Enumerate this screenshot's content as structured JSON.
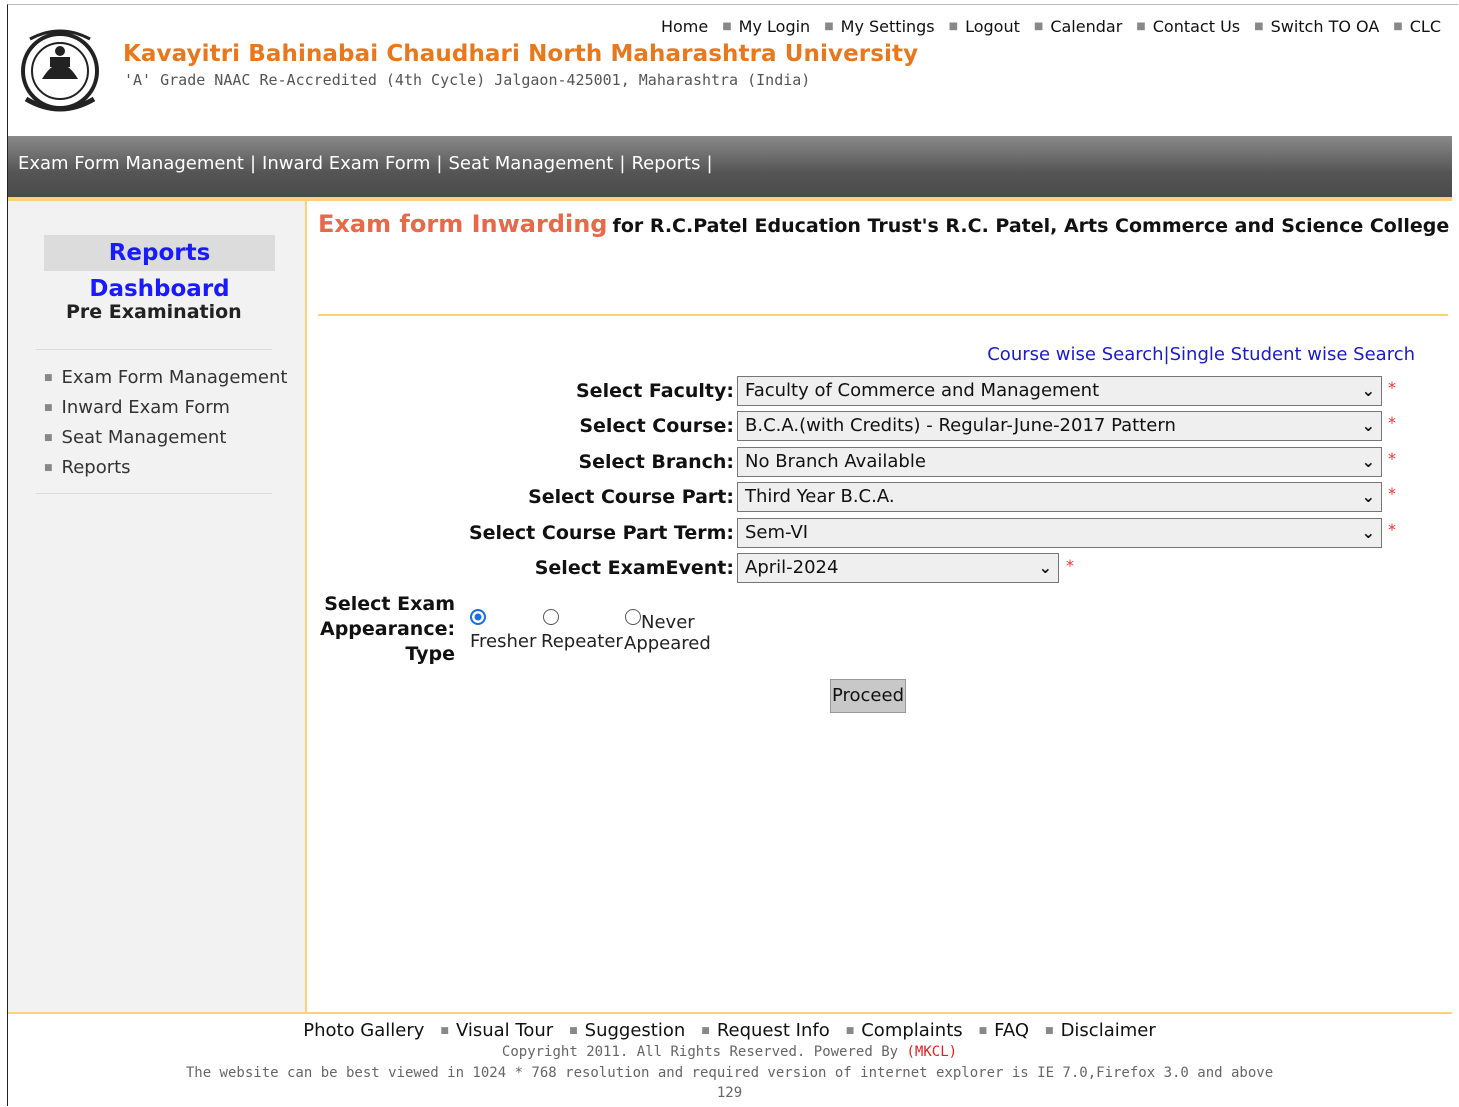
{
  "header": {
    "university_name": "Kavayitri Bahinabai Chaudhari North Maharashtra University",
    "subtitle": "'A' Grade NAAC Re-Accredited (4th Cycle) Jalgaon-425001, Maharashtra (India)",
    "top_links": [
      "Home",
      "My Login",
      "My Settings",
      "Logout",
      "Calendar",
      "Contact Us",
      "Switch TO OA",
      "CLC"
    ]
  },
  "navbar": {
    "items": [
      "Exam Form Management",
      "Inward Exam Form",
      "Seat Management",
      "Reports"
    ]
  },
  "sidebar": {
    "title": "Reports Dashboard",
    "section": "Pre Examination",
    "items": [
      "Exam Form Management",
      "Inward Exam Form",
      "Seat Management",
      "Reports"
    ]
  },
  "main": {
    "title": "Exam form Inwarding",
    "title_suffix": "for R.C.Patel Education Trust's R.C. Patel, Arts Commerce and Science College",
    "search_links": [
      "Course wise Search",
      "Single Student wise Search"
    ],
    "search_sep": "|",
    "fields": {
      "faculty": {
        "label": "Select Faculty",
        "value": "Faculty of Commerce and Management"
      },
      "course": {
        "label": "Select Course",
        "value": "B.C.A.(with Credits) - Regular-June-2017 Pattern"
      },
      "branch": {
        "label": "Select Branch",
        "value": "No Branch Available"
      },
      "course_part": {
        "label": "Select Course Part",
        "value": "Third Year B.C.A."
      },
      "course_part_term": {
        "label": "Select Course Part Term",
        "value": "Sem-VI"
      },
      "exam_event": {
        "label": "Select ExamEvent",
        "value": "April-2024"
      }
    },
    "label_colon": ":",
    "required_mark": "*",
    "appearance": {
      "label_lines": [
        "Select Exam",
        "Appearance",
        "Type"
      ],
      "options": [
        {
          "line1": "",
          "line2": "Fresher",
          "selected": true
        },
        {
          "line1": "",
          "line2": "Repeater",
          "selected": false
        },
        {
          "line1": "Never",
          "line2": "Appeared",
          "selected": false
        }
      ]
    },
    "proceed_label": "Proceed"
  },
  "footer": {
    "links": [
      "Photo Gallery",
      "Visual Tour",
      "Suggestion",
      "Request Info",
      "Complaints",
      "FAQ",
      "Disclaimer"
    ],
    "copyright": "Copyright 2011. All Rights Reserved. Powered By",
    "mkcl": "(MKCL)",
    "resolution_note": "The website can be best viewed in 1024 * 768 resolution and required version of internet explorer is IE 7.0,Firefox 3.0 and above",
    "counter": "129"
  },
  "colors": {
    "university_orange": "#e8781e",
    "title_coral": "#e8694a",
    "accent_yellow": "#fbd27a",
    "link_blue": "#1a1acc",
    "required_red": "#e33333"
  }
}
